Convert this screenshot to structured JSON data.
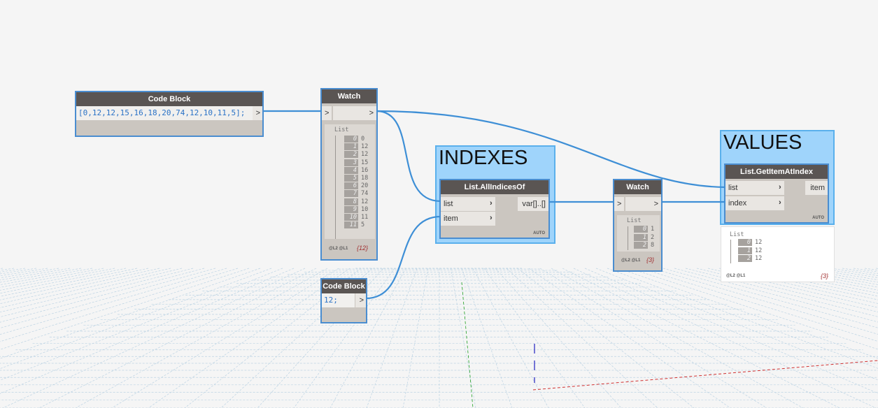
{
  "nodes": {
    "code_block_1": {
      "title": "Code Block",
      "code": "[0,12,12,15,16,18,20,74,12,10,11,5];",
      "out_port": ">"
    },
    "watch_1": {
      "title": "Watch",
      "in_port": ">",
      "out_port": ">",
      "list_label": "List",
      "items": [
        {
          "index": "0",
          "value": "0"
        },
        {
          "index": "1",
          "value": "12"
        },
        {
          "index": "2",
          "value": "12"
        },
        {
          "index": "3",
          "value": "15"
        },
        {
          "index": "4",
          "value": "16"
        },
        {
          "index": "5",
          "value": "18"
        },
        {
          "index": "6",
          "value": "20"
        },
        {
          "index": "7",
          "value": "74"
        },
        {
          "index": "8",
          "value": "12"
        },
        {
          "index": "9",
          "value": "10"
        },
        {
          "index": "10",
          "value": "11"
        },
        {
          "index": "11",
          "value": "5"
        }
      ],
      "lacing": "@L2 @L1",
      "count": "{12}"
    },
    "code_block_2": {
      "title": "Code Block",
      "code": "12;",
      "out_port": ">"
    },
    "all_indices_of": {
      "title": "List.AllIndicesOf",
      "in_ports": [
        "list",
        "item"
      ],
      "out_port": "var[]..[]",
      "lacing": "AUTO"
    },
    "watch_2": {
      "title": "Watch",
      "in_port": ">",
      "out_port": ">",
      "list_label": "List",
      "items": [
        {
          "index": "0",
          "value": "1"
        },
        {
          "index": "1",
          "value": "2"
        },
        {
          "index": "2",
          "value": "8"
        }
      ],
      "lacing": "@L2 @L1",
      "count": "{3}"
    },
    "get_item_at_index": {
      "title": "List.GetItemAtIndex",
      "in_ports": [
        "list",
        "index"
      ],
      "out_port": "item",
      "lacing": "AUTO",
      "preview": {
        "list_label": "List",
        "items": [
          {
            "index": "0",
            "value": "12"
          },
          {
            "index": "1",
            "value": "12"
          },
          {
            "index": "2",
            "value": "12"
          }
        ],
        "lacing": "@L2 @L1",
        "count": "{3}"
      }
    }
  },
  "groups": {
    "indexes": {
      "title": "INDEXES",
      "color": "#9fd4fb"
    },
    "values": {
      "title": "VALUES",
      "color": "#9fd4fb"
    }
  },
  "colors": {
    "wire": "#3e8fd6",
    "node_border": "#4a8dd0",
    "header": "#5a5553",
    "grid": "#bcd3e3",
    "axis_x": "#d03030",
    "axis_y": "#2020c0",
    "axis_z": "#20a020"
  }
}
